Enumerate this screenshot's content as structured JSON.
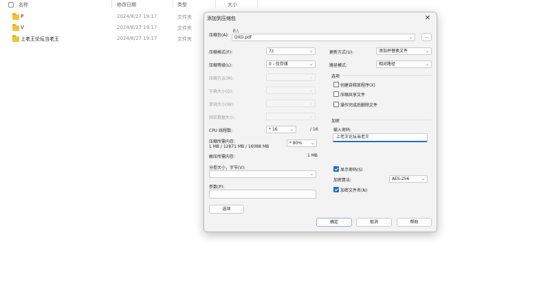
{
  "explorer": {
    "columns": {
      "name": "名称",
      "modified": "修改日期",
      "type": "类型",
      "size": "大小"
    },
    "rows": [
      {
        "name": "P",
        "modified": "2024/8/27 19:17",
        "type": "文件夹"
      },
      {
        "name": "V",
        "modified": "2024/8/27 19:17",
        "type": "文件夹"
      },
      {
        "name": "上老王论坛当老王",
        "modified": "2024/8/27 19:17",
        "type": "文件夹"
      }
    ]
  },
  "dialog": {
    "title": "添加到压缩包",
    "archive_label": "压缩包(A):",
    "archive_dir": "E:\\",
    "archive_name": "DXD.pdf",
    "browse_label": "...",
    "left": {
      "format_label": "压缩格式(F):",
      "format_value": "7z",
      "level_label": "压缩等级(L):",
      "level_value": "0 - 仅存储",
      "method_label": "压缩方法(M):",
      "dict_label": "字典大小(D):",
      "word_label": "单词大小(W):",
      "solid_label": "固实数据大小:",
      "cpu_label": "CPU 线程数:",
      "cpu_value": "* 16",
      "cpu_total": "/ 16",
      "mem_compress_label": "压缩所需内存:",
      "mem_compress_detail": "1 MB / 12871 MB / 16088 MB",
      "mem_percent": "* 80%",
      "mem_decompress_label": "解压所需内存:",
      "mem_decompress_value": "1 MB",
      "split_label": "分卷大小，字节(V):",
      "params_label": "参数(P):",
      "options_button": "选项"
    },
    "right": {
      "update_label": "更新方式(U):",
      "update_value": "添加并替换文件",
      "path_label": "路径模式:",
      "path_value": "相对路径",
      "options_group": "选项",
      "opt_sfx": "创建自释放程序(X)",
      "opt_shared": "压缩共享文件",
      "opt_delete": "操作完成后删除文件",
      "encrypt_group": "加密",
      "pwd_label": "输入密码:",
      "pwd_value": "上老王论坛当老王",
      "show_pwd": "显示密码(S)",
      "enc_method_label": "加密算法:",
      "enc_method_value": "AES-256",
      "enc_names": "加密文件名(N)"
    },
    "buttons": {
      "ok": "确定",
      "cancel": "取消",
      "help": "帮助"
    }
  }
}
